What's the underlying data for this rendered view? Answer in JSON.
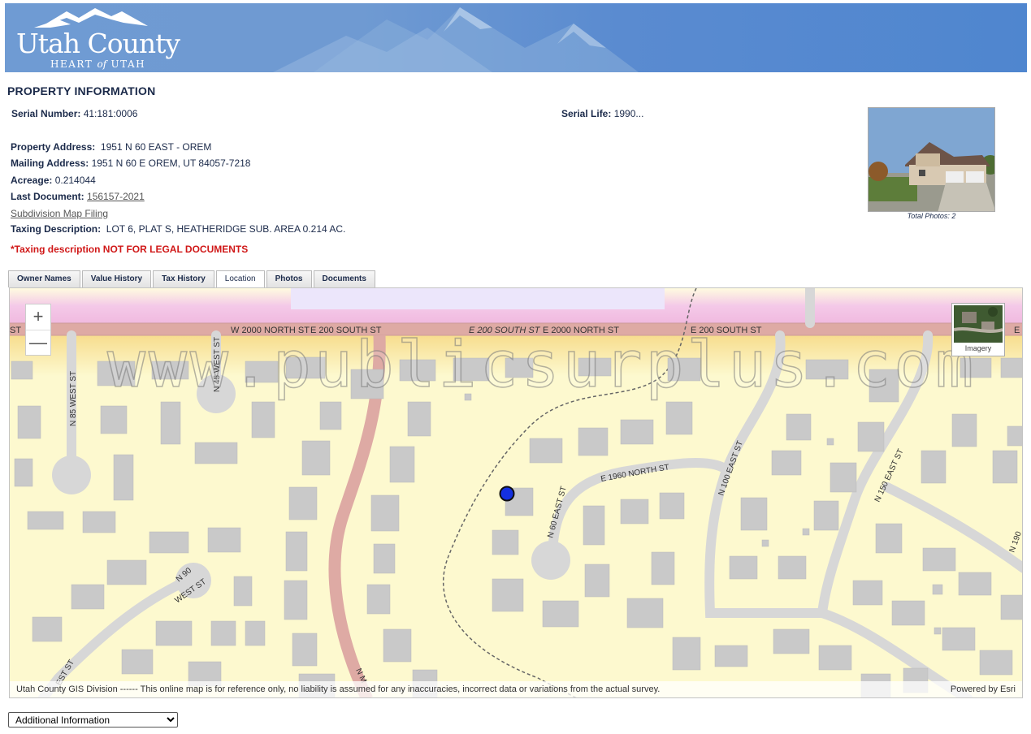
{
  "header": {
    "logo_title": "Utah County",
    "logo_sub_a": "HEART ",
    "logo_sub_of": "of",
    "logo_sub_b": " UTAH"
  },
  "property": {
    "section_title": "PROPERTY INFORMATION",
    "serial_number_label": "Serial Number:",
    "serial_number": "41:181:0006",
    "serial_life_label": "Serial Life:",
    "serial_life": "1990...",
    "property_address_label": "Property Address:",
    "property_address": "1951 N 60 EAST - OREM",
    "mailing_address_label": "Mailing Address:",
    "mailing_address": "1951 N 60 E OREM, UT 84057-7218",
    "acreage_label": "Acreage:",
    "acreage": "0.214044",
    "last_document_label": "Last Document:",
    "last_document": "156157-2021",
    "subdivision_link": "Subdivision Map Filing",
    "taxing_description_label": "Taxing Description:",
    "taxing_description": "LOT 6, PLAT S, HEATHERIDGE SUB. AREA 0.214 AC.",
    "warning": "*Taxing description NOT FOR LEGAL DOCUMENTS",
    "total_photos": "Total Photos: 2"
  },
  "tabs": [
    {
      "label": "Owner Names"
    },
    {
      "label": "Value History"
    },
    {
      "label": "Tax History"
    },
    {
      "label": "Location"
    },
    {
      "label": "Photos"
    },
    {
      "label": "Documents"
    }
  ],
  "map": {
    "streets": {
      "w2000": "W 2000 NORTH ST",
      "e200a": "E 200 SOUTH ST",
      "e200b": "E 200 SOUTH ST",
      "e2000": "E 2000 NORTH ST",
      "e200c": "E 200 SOUTH ST",
      "st_left": "ST",
      "e_right": "E",
      "n85": "N 85 WEST ST",
      "n45": "N 45 WEST ST",
      "n90": "N 90",
      "west_st": "WEST ST",
      "est_st": "EST ST",
      "n_main": "N M",
      "n60": "N 60 EAST ST",
      "e1960": "E 1960 NORTH ST",
      "n100": "N 100 EAST ST",
      "n150": "N 150 EAST ST",
      "n190": "N 190"
    },
    "zoom_in": "+",
    "zoom_out": "—",
    "imagery_label": "Imagery",
    "watermark": "www.publicsurplus.com",
    "attribution": "Utah County GIS Division ------ This online map is for reference only, no liability is assumed for any inaccuracies, incorrect data or variations from the actual survey.",
    "powered_by": "Powered by Esri",
    "colors": {
      "land": "#fdf9cf",
      "road": "#d7d7d7",
      "arterial": "#deaaa4",
      "building": "#c9c9c9",
      "marker": "#1430e0"
    }
  },
  "additional_select": {
    "selected": "Additional Information"
  }
}
